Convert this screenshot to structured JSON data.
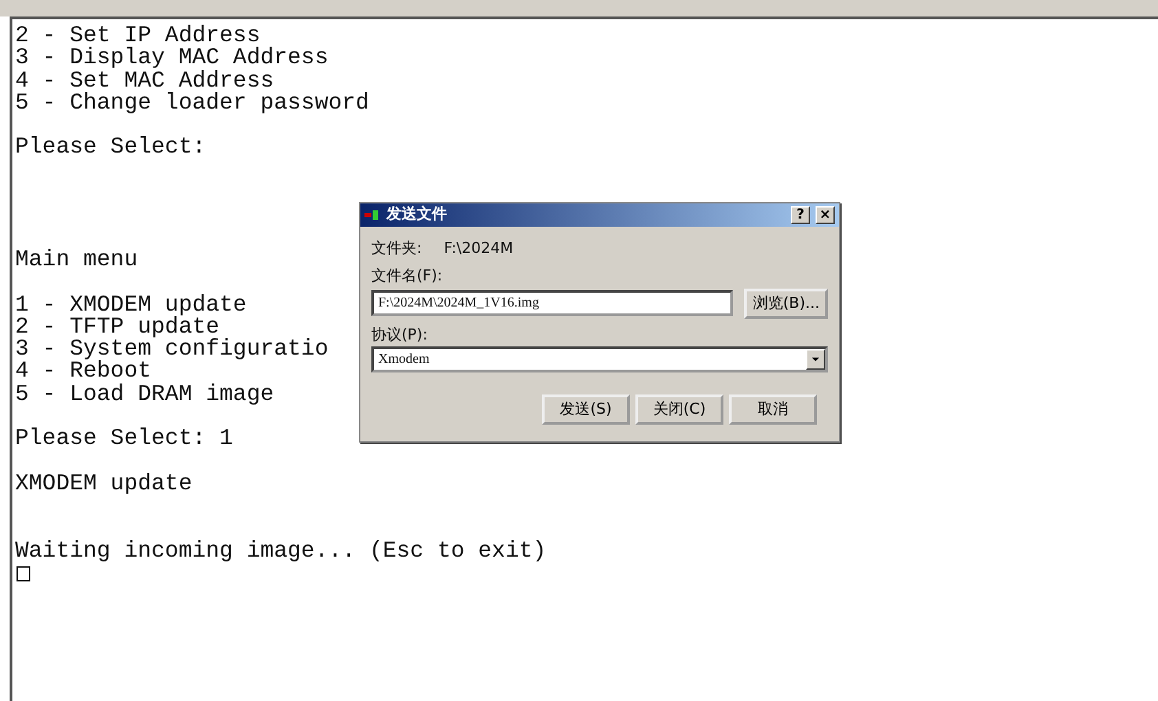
{
  "terminal": {
    "lines": [
      {
        "kind": "text",
        "text": "2 - Set IP Address"
      },
      {
        "kind": "text",
        "text": "3 - Display MAC Address"
      },
      {
        "kind": "text",
        "text": "4 - Set MAC Address"
      },
      {
        "kind": "text",
        "text": "5 - Change loader password"
      },
      {
        "kind": "blank"
      },
      {
        "kind": "text",
        "text": "Please Select:"
      },
      {
        "kind": "blank"
      },
      {
        "kind": "blank"
      },
      {
        "kind": "blank"
      },
      {
        "kind": "blank"
      },
      {
        "kind": "text",
        "text": "Main menu"
      },
      {
        "kind": "blank"
      },
      {
        "kind": "text",
        "text": "1 - XMODEM update"
      },
      {
        "kind": "text",
        "text": "2 - TFTP update"
      },
      {
        "kind": "text",
        "text": "3 - System configuratio"
      },
      {
        "kind": "text",
        "text": "4 - Reboot"
      },
      {
        "kind": "text",
        "text": "5 - Load DRAM image"
      },
      {
        "kind": "blank"
      },
      {
        "kind": "text",
        "text": "Please Select: 1"
      },
      {
        "kind": "blank"
      },
      {
        "kind": "text",
        "text": "XMODEM update"
      },
      {
        "kind": "blank"
      },
      {
        "kind": "blank"
      },
      {
        "kind": "text",
        "text": "Waiting incoming image... (Esc to exit)"
      },
      {
        "kind": "cursor"
      }
    ]
  },
  "dialog": {
    "title": "发送文件",
    "help": "?",
    "close": "×",
    "folder_label": "文件夹:",
    "folder_value": "F:\\2024M",
    "filename_label": "文件名(F):",
    "filename_value": "F:\\2024M\\2024M_1V16.img",
    "browse": "浏览(B)...",
    "protocol_label": "协议(P):",
    "protocol_value": "Xmodem",
    "buttons": [
      "发送(S)",
      "关闭(C)",
      "取消"
    ]
  }
}
